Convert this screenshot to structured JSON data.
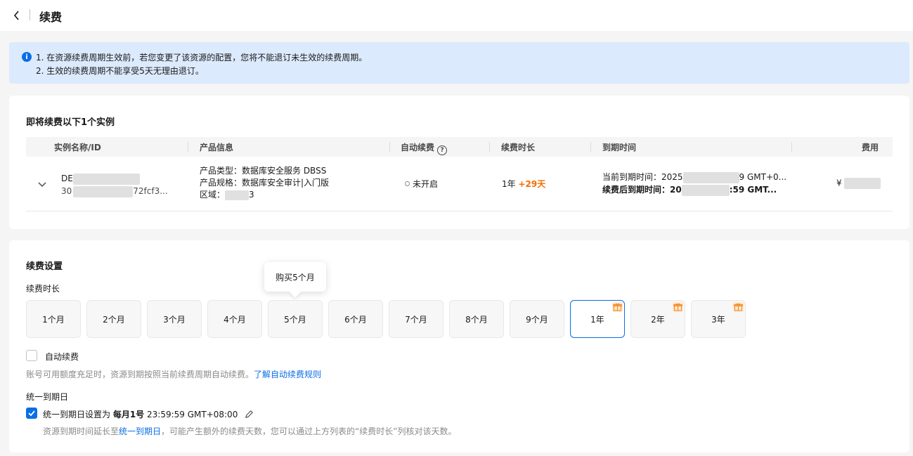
{
  "header": {
    "title": "续费"
  },
  "notice": {
    "line1": "1. 在资源续费周期生效前，若您变更了该资源的配置，您将不能退订未生效的续费周期。",
    "line2": "2. 生效的续费周期不能享受5天无理由退订。"
  },
  "instances": {
    "title": "即将续费以下1个实例",
    "columns": [
      "实例名称/ID",
      "产品信息",
      "自动续费",
      "续费时长",
      "到期时间",
      "费用"
    ],
    "row": {
      "name_prefix": "DE",
      "id_prefix": "30",
      "id_suffix": "72fcf3...",
      "product_type": "产品类型：数据库安全服务 DBSS",
      "product_spec": "产品规格：数据库安全审计|入门版",
      "region_label": "区域：",
      "region_suffix": "3",
      "auto_renew": "未开启",
      "duration": "1年",
      "duration_bonus": "+29天",
      "expire_current_label": "当前到期时间：2025",
      "expire_current_suffix": "9 GMT+0...",
      "expire_after_label": "续费后到期时间：20",
      "expire_after_suffix": ":59 GMT...",
      "cost_prefix": "¥"
    }
  },
  "settings": {
    "title": "续费设置",
    "duration_label": "续费时长",
    "tooltip": "购买5个月",
    "options": [
      "1个月",
      "2个月",
      "3个月",
      "4个月",
      "5个月",
      "6个月",
      "7个月",
      "8个月",
      "9个月",
      "1年",
      "2年",
      "3年"
    ],
    "selected": "1年",
    "auto_renew_label": "自动续费",
    "auto_renew_desc": "账号可用额度充足时，资源到期按照当前续费周期自动续费。",
    "auto_renew_link": "了解自动续费规则",
    "unify_label": "统一到期日",
    "unify_check_prefix": "统一到期日设置为 ",
    "unify_day": "每月1号",
    "unify_time": " 23:59:59 GMT+08:00",
    "unify_desc_prefix": "资源到期时间延长至",
    "unify_desc_link": "统一到期日",
    "unify_desc_suffix": "，可能产生额外的续费天数，您可以通过上方列表的“续费时长”列核对该天数。"
  }
}
